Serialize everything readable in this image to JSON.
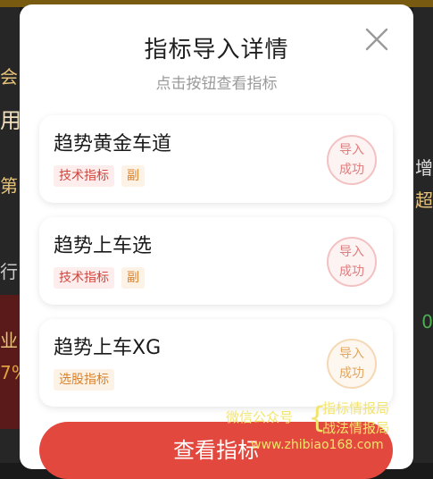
{
  "background": {
    "left_fragments": [
      "会",
      "用",
      "第",
      "行",
      "业",
      "7%"
    ],
    "right_fragments": [
      "增",
      "超",
      "0"
    ]
  },
  "modal": {
    "title": "指标导入详情",
    "subtitle": "点击按钮查看指标",
    "close_icon": "close-icon"
  },
  "cards": [
    {
      "name": "趋势黄金车道",
      "tags": [
        "技术指标",
        "副"
      ],
      "status_line1": "导入",
      "status_line2": "成功",
      "stamp_color": "#e07d7d"
    },
    {
      "name": "趋势上车选",
      "tags": [
        "技术指标",
        "副"
      ],
      "status_line1": "导入",
      "status_line2": "成功",
      "stamp_color": "#e07d7d"
    },
    {
      "name": "趋势上车XG",
      "tags": [
        "选股指标"
      ],
      "status_line1": "导入",
      "status_line2": "成功",
      "stamp_color": "#e2a660"
    }
  ],
  "button": {
    "label": "查看指标"
  },
  "watermark": {
    "wechat": "微信公众号",
    "line1": "指标情报局",
    "line2": "战法情报局",
    "url": "www.zhibiao168.com"
  },
  "colors": {
    "primary": "#e2483d",
    "tag_red": "#d0453c",
    "tag_orange": "#d9822b"
  }
}
